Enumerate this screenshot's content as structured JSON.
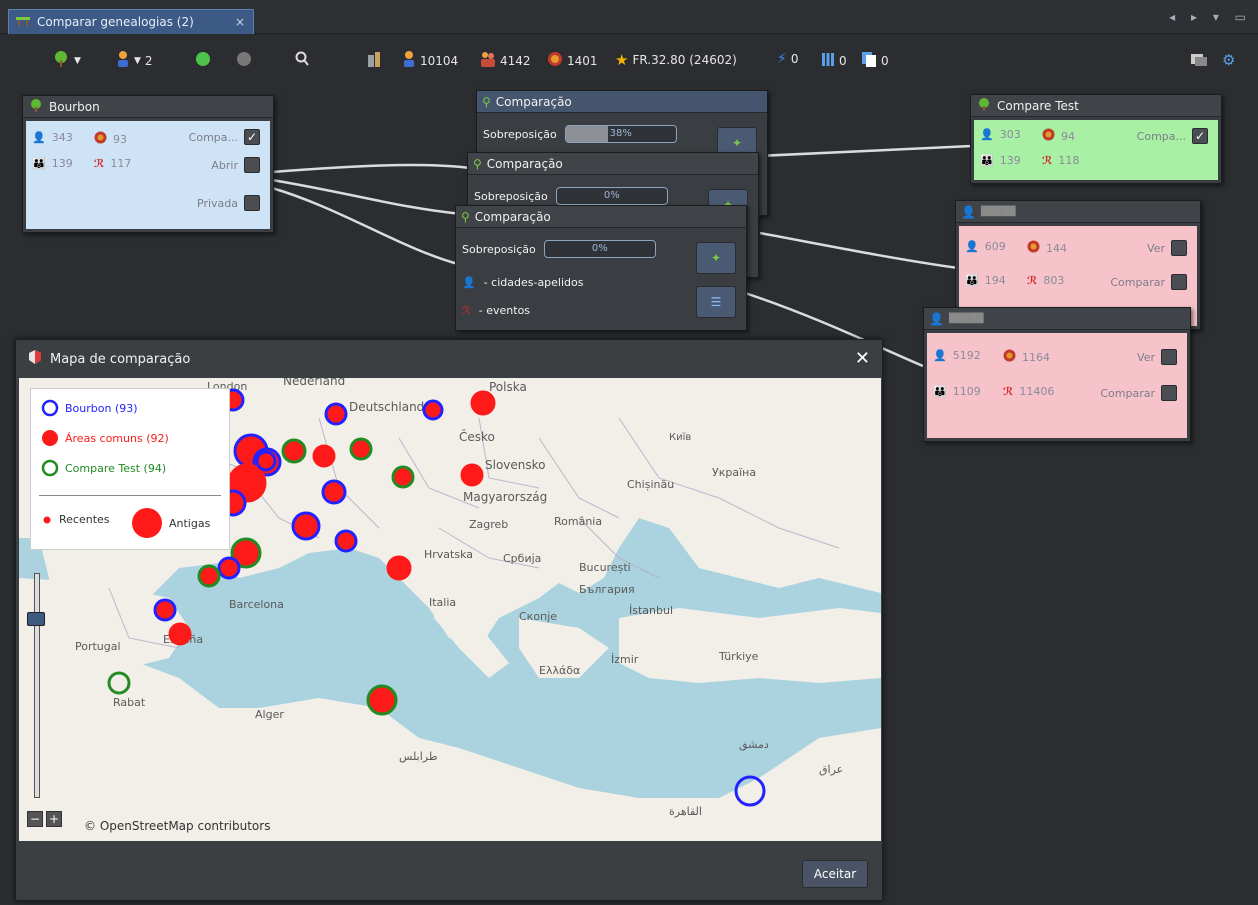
{
  "tab": {
    "title": "Comparar genealogias (2)",
    "close": "×"
  },
  "toolbar": {
    "people_count": "2",
    "stat_people": "10104",
    "stat_families": "4142",
    "stat_places": "1401",
    "stat_fr": "FR.32.80 (24602)",
    "stat_a": "0",
    "stat_b": "0",
    "stat_c": "0"
  },
  "bourbon": {
    "title": "Bourbon",
    "people": "343",
    "places": "93",
    "families": "139",
    "events": "117",
    "compare_label": "Compa...",
    "open_label": "Abrir",
    "private_label": "Privada"
  },
  "comparacao": [
    {
      "title": "Comparação",
      "overlap_label": "Sobreposição",
      "overlap_pct": "38%",
      "overlap_value": 0.38
    },
    {
      "title": "Comparação",
      "overlap_label": "Sobreposição",
      "overlap_pct": "0%",
      "overlap_value": 0.0
    },
    {
      "title": "Comparação",
      "overlap_label": "Sobreposição",
      "overlap_pct": "0%",
      "overlap_value": 0.0,
      "line1": "- cidades-apelidos",
      "line2": "- eventos"
    }
  ],
  "compare_test": {
    "title": "Compare Test",
    "people": "303",
    "places": "94",
    "families": "139",
    "events": "118",
    "compare_label": "Compa..."
  },
  "pink1": {
    "title": "█████",
    "people": "609",
    "places": "144",
    "families": "194",
    "events": "803",
    "view_label": "Ver",
    "compare_label": "Comparar"
  },
  "pink2": {
    "title": "█████",
    "people": "5192",
    "places": "1164",
    "families": "1109",
    "events": "11406",
    "view_label": "Ver",
    "compare_label": "Comparar"
  },
  "dialog": {
    "title": "Mapa de comparação",
    "close": "✕",
    "ok_label": "Aceitar",
    "attribution": "© OpenStreetMap contributors",
    "legend": {
      "bourbon": "Bourbon (93)",
      "common": "Áreas comuns (92)",
      "compare": "Compare Test (94)",
      "recent": "Recentes",
      "old": "Antigas"
    },
    "labels": [
      "London",
      "Nederland",
      "Deutschland",
      "Polska",
      "Česko",
      "Київ",
      "Slovensko",
      "Україна",
      "Magyarország",
      "Chișinău",
      "Zagreb",
      "România",
      "Hrvatska",
      "Србија",
      "București",
      "България",
      "Barcelona",
      "Italia",
      "Скопје",
      "İstanbul",
      "Portugal",
      "España",
      "Ελλάδα",
      "İzmir",
      "Türkiye",
      "Rabat",
      "Alger",
      "طرابلس",
      "القاهرة",
      "دمشق",
      "عراق"
    ],
    "zoom_minus": "−",
    "zoom_plus": "+"
  },
  "colors": {
    "bourbon": "#2222ff",
    "common": "#ff0000",
    "compare": "#228b22"
  }
}
